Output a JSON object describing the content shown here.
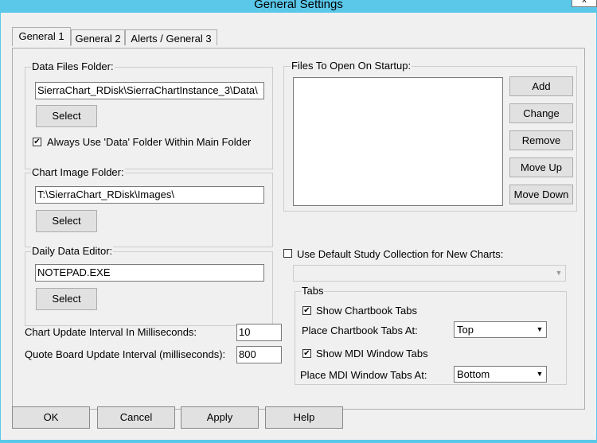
{
  "window": {
    "title": "General Settings",
    "close_glyph": "x"
  },
  "tabs": [
    "General 1",
    "General 2",
    "Alerts / General 3"
  ],
  "data_files": {
    "label": "Data Files Folder:",
    "value": "SierraChart_RDisk\\SierraChartInstance_3\\Data\\",
    "select_label": "Select",
    "checkbox_label": "Always Use 'Data' Folder Within Main Folder",
    "checked": true
  },
  "chart_image": {
    "label": "Chart Image Folder:",
    "value": "T:\\SierraChart_RDisk\\Images\\",
    "select_label": "Select"
  },
  "daily_data": {
    "label": "Daily Data Editor:",
    "value": "NOTEPAD.EXE",
    "select_label": "Select"
  },
  "intervals": {
    "chart_update_label": "Chart Update Interval In Milliseconds:",
    "chart_update_value": "10",
    "quote_board_label": "Quote Board Update Interval (milliseconds):",
    "quote_board_value": "800"
  },
  "startup_files": {
    "label": "Files To Open On Startup:",
    "buttons": [
      "Add",
      "Change",
      "Remove",
      "Move Up",
      "Move Down"
    ]
  },
  "study_collection": {
    "label": "Use Default Study Collection for New Charts:",
    "checked": false,
    "value": ""
  },
  "tabs_group": {
    "label": "Tabs",
    "show_chartbook_label": "Show Chartbook Tabs",
    "show_chartbook_checked": true,
    "place_chartbook_label": "Place Chartbook Tabs At:",
    "place_chartbook_value": "Top",
    "show_mdi_label": "Show MDI Window Tabs",
    "show_mdi_checked": true,
    "place_mdi_label": "Place MDI Window Tabs At:",
    "place_mdi_value": "Bottom"
  },
  "footer": {
    "ok": "OK",
    "cancel": "Cancel",
    "apply": "Apply",
    "help": "Help"
  },
  "glyphs": {
    "check": "✔",
    "dropdown": "▼"
  }
}
